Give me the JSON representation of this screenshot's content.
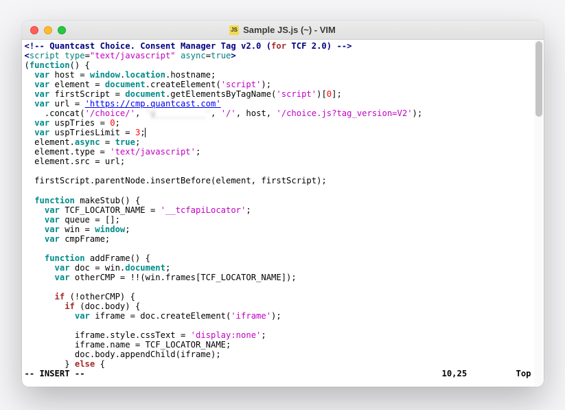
{
  "window": {
    "title": "Sample JS.js (~) - VIM"
  },
  "code": {
    "comment_open": "<!--",
    "comment_text": " Quantcast Choice. Consent Manager Tag v2.0 (",
    "comment_for": "for",
    "comment_tcf": " TCF 2.0) ",
    "comment_close": "-->",
    "script_open_lt": "<",
    "script_tag": "script",
    "script_attr_type_k": " type",
    "eq": "=",
    "script_attr_type_v": "\"text/javascript\"",
    "script_attr_async_k": " async",
    "script_attr_async_v": "true",
    "script_open_gt": ">",
    "iife_open": "(",
    "fn_kw": "function",
    "iife_paren": "() {",
    "var_kw": "var",
    "host_line_a": " host = ",
    "window_kw": "window",
    "host_line_b": ".",
    "location_kw": "location",
    "host_line_c": ".hostname;",
    "elem_line_a": " element = ",
    "document_kw": "document",
    "elem_line_b": ".createElement(",
    "str_script": "'script'",
    "elem_line_c": ");",
    "first_line_a": " firstScript = ",
    "first_line_b": ".getElementsByTagName(",
    "first_line_c": ")[",
    "zero": "0",
    "first_line_d": "];",
    "url_line_a": " url = ",
    "url_str": "'https://cmp.quantcast.com'",
    "concat_a": "    .concat(",
    "concat_choice": "'/choice/'",
    "concat_sep": ", ",
    "concat_blur": "'g__________'",
    "concat_slash": "'/'",
    "concat_host": ", host, ",
    "concat_tail": "'/choice.js?tag_version=V2'",
    "concat_end": ");",
    "tries_a": " uspTries = ",
    "tries_v": "0",
    "semi": ";",
    "limit_a": " uspTriesLimit = ",
    "limit_v": "3",
    "async_a": "  element.",
    "async_kw": "async",
    "async_b": " = ",
    "true_kw": "true",
    "type_a": "  element.type = ",
    "type_v": "'text/javascript'",
    "src_a": "  element.src = url;",
    "insert_a": "  firstScript.parentNode.insertBefore(element, firstScript);",
    "mk_a": " makeStub() {",
    "tcf_a": " TCF_LOCATOR_NAME = ",
    "tcf_v": "'__tcfapiLocator'",
    "queue_a": " queue = [];",
    "win_a": " win = ",
    "cmp_a": " cmpFrame;",
    "addframe_a": " addFrame() {",
    "doc_a": " doc = win.",
    "other_a": " otherCMP = !!(win.frames[TCF_LOCATOR_NAME]);",
    "if_kw": "if",
    "not_other": " (!otherCMP) {",
    "doc_body": " (doc.body) {",
    "iframe_a": " iframe = doc.createElement(",
    "iframe_v": "'iframe'",
    "iframe_b": ");",
    "css_a": "          iframe.style.cssText = ",
    "css_v": "'display:none'",
    "name_a": "          iframe.name = TCF_LOCATOR_NAME;",
    "append_a": "          doc.body.appendChild(iframe);",
    "else_a": "        } ",
    "else_kw": "else",
    "else_b": " {"
  },
  "status": {
    "mode": "-- INSERT --",
    "pos": "10,25",
    "scroll": "Top"
  }
}
